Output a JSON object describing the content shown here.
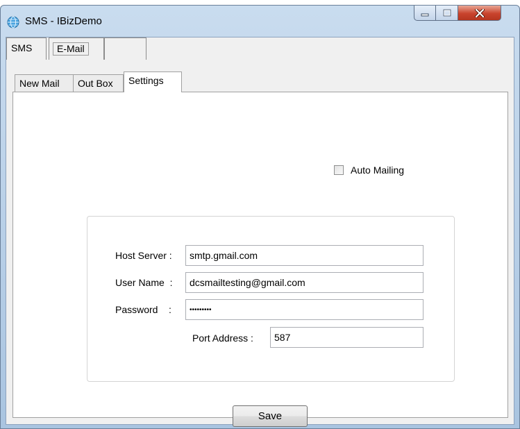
{
  "window": {
    "title": "SMS - IBizDemo"
  },
  "outer_tabs": [
    "SMS",
    "E-Mail",
    ""
  ],
  "inner_tabs": [
    "New Mail",
    "Out Box",
    "Settings"
  ],
  "settings": {
    "auto_mailing_label": "Auto Mailing",
    "auto_mailing_checked": false,
    "host_label": "Host Server :",
    "host_value": "smtp.gmail.com",
    "user_label": "User Name  :",
    "user_value": "dcsmailtesting@gmail.com",
    "password_label": "Password    :",
    "password_value": "•••••••••",
    "port_label": "Port Address :",
    "port_value": "587",
    "save_label": "Save"
  },
  "icons": {
    "app": "globe-icon",
    "minimize": "minimize-icon",
    "maximize": "maximize-icon",
    "close": "close-icon"
  },
  "colors": {
    "close_button": "#c9432d",
    "title_bar": "#c9dcef",
    "panel": "#ffffff"
  }
}
